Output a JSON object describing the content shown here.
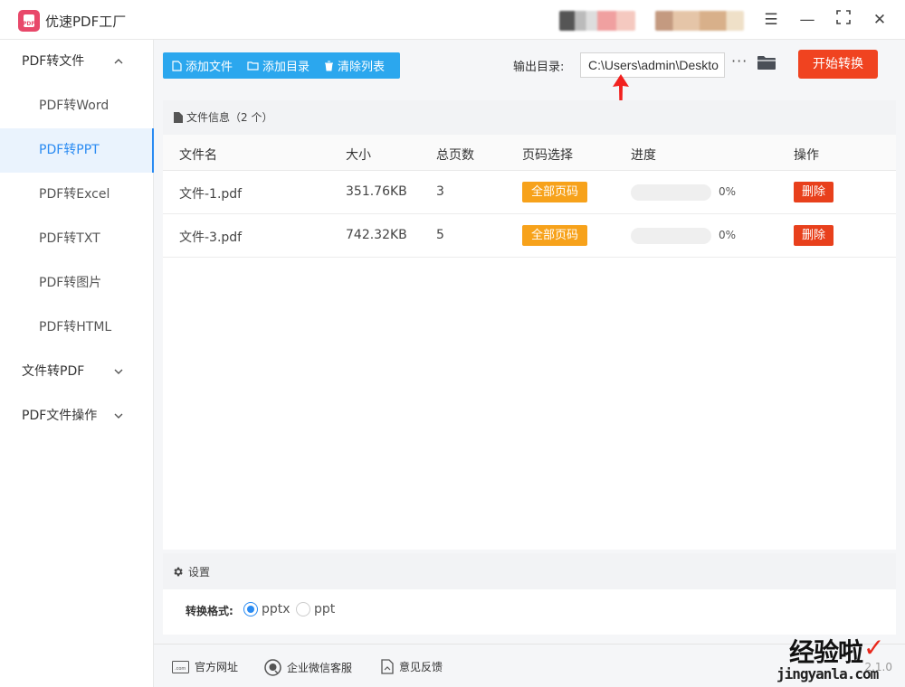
{
  "app": {
    "title": "优速PDF工厂"
  },
  "window_controls": {
    "menu": "☰",
    "minimize": "—",
    "maximize": "⛶",
    "close": "✕"
  },
  "sidebar": {
    "groups": [
      {
        "label": "PDF转文件",
        "expanded": true,
        "chevron": "^"
      },
      {
        "label": "文件转PDF",
        "expanded": false,
        "chevron": "⌄"
      },
      {
        "label": "PDF文件操作",
        "expanded": false,
        "chevron": "⌄"
      }
    ],
    "items": [
      {
        "label": "PDF转Word",
        "active": false
      },
      {
        "label": "PDF转PPT",
        "active": true
      },
      {
        "label": "PDF转Excel",
        "active": false
      },
      {
        "label": "PDF转TXT",
        "active": false
      },
      {
        "label": "PDF转图片",
        "active": false
      },
      {
        "label": "PDF转HTML",
        "active": false
      }
    ]
  },
  "toolbar": {
    "add_file": "添加文件",
    "add_folder": "添加目录",
    "clear_list": "清除列表",
    "output_label": "输出目录:",
    "output_path": "C:\\Users\\admin\\Deskto",
    "more": "···",
    "start": "开始转换"
  },
  "files": {
    "header": "文件信息（2 个）",
    "columns": [
      "文件名",
      "大小",
      "总页数",
      "页码选择",
      "进度",
      "操作"
    ],
    "rows": [
      {
        "name": "文件-1.pdf",
        "size": "351.76KB",
        "pages": "3",
        "page_select": "全部页码",
        "progress_text": "0%",
        "progress": 0,
        "action": "删除"
      },
      {
        "name": "文件-3.pdf",
        "size": "742.32KB",
        "pages": "5",
        "page_select": "全部页码",
        "progress_text": "0%",
        "progress": 0,
        "action": "删除"
      }
    ]
  },
  "settings": {
    "title": "设置",
    "format_label": "转换格式:",
    "options": [
      {
        "label": "pptx",
        "checked": true
      },
      {
        "label": "ppt",
        "checked": false
      }
    ]
  },
  "footer": {
    "website": "官方网址",
    "wechat": "企业微信客服",
    "feedback": "意见反馈",
    "version": "2.1.0"
  },
  "watermark": {
    "main": "经验啦",
    "check": "✓",
    "sub": "jingyanla.com"
  },
  "colors": {
    "accent_blue": "#2ba7ee",
    "start_red": "#f04320",
    "delete_red": "#e8401c",
    "badge_orange": "#f7a21b",
    "active_blue": "#2a8bf2"
  }
}
